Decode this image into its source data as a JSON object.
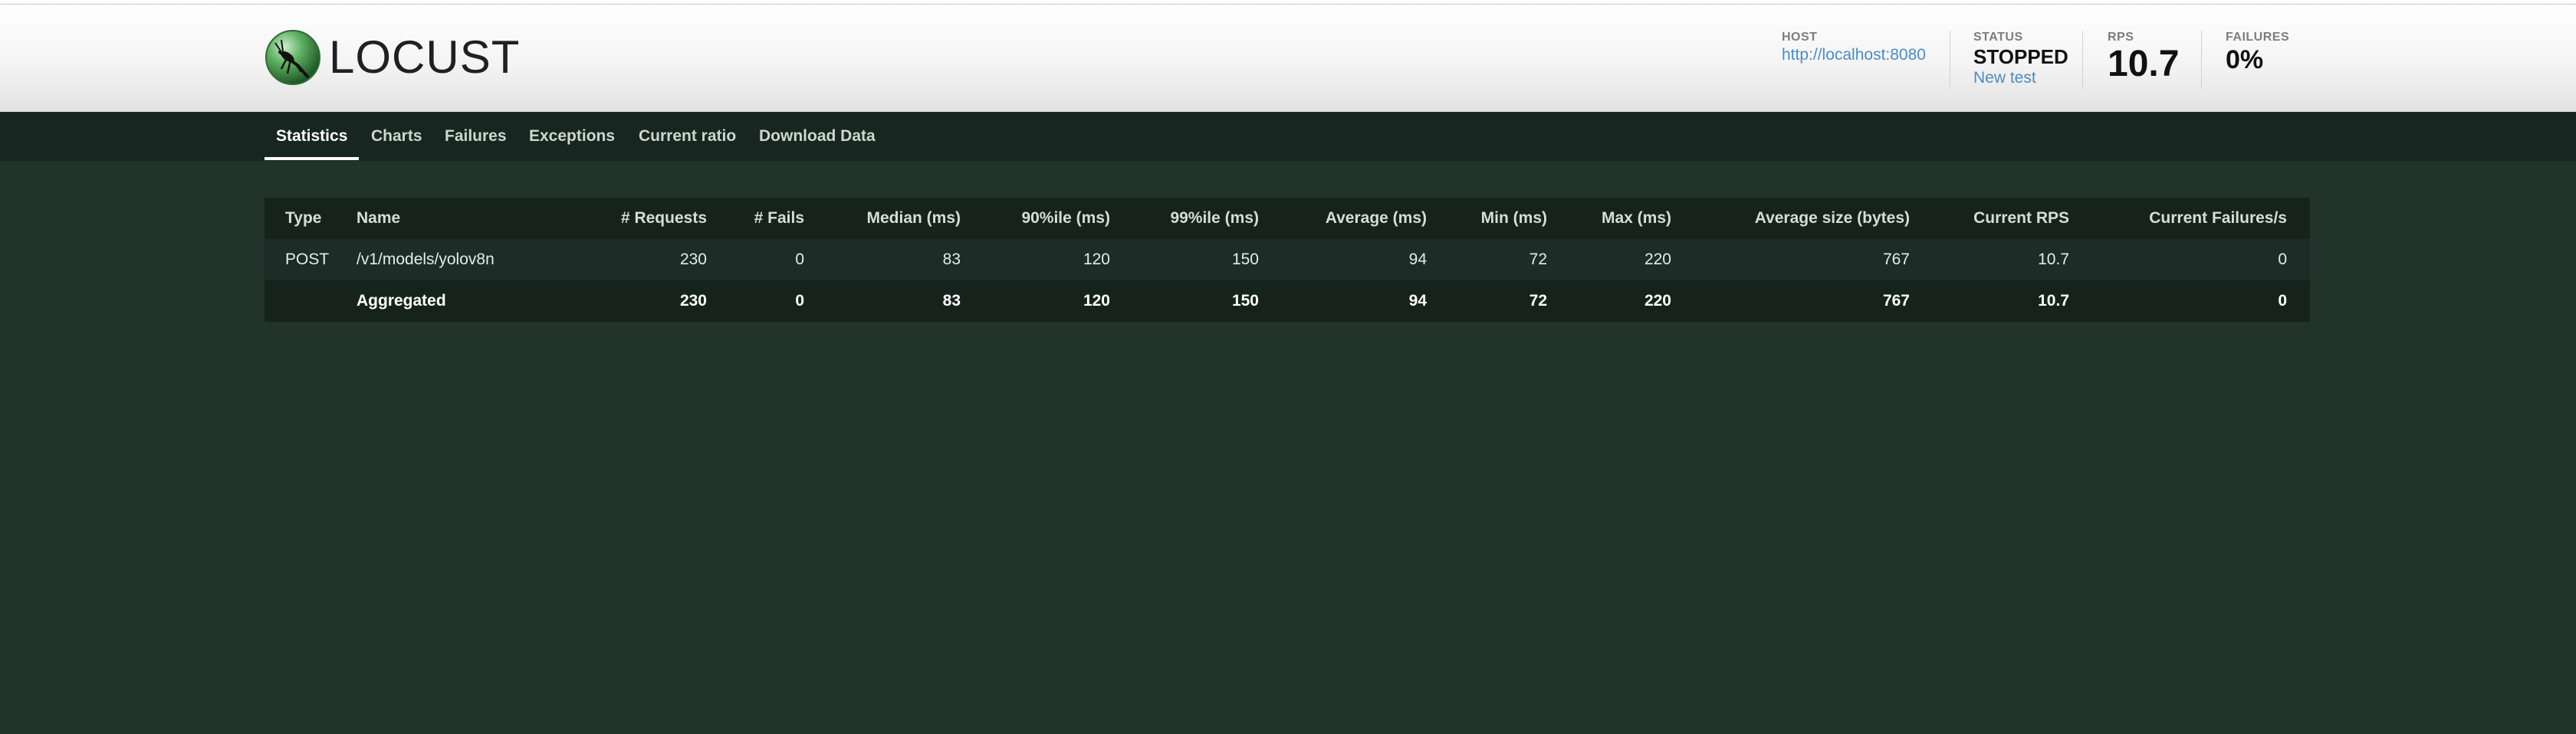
{
  "app": {
    "logo_text": "LOCUST"
  },
  "header": {
    "host": {
      "label": "HOST",
      "value": "http://localhost:8080"
    },
    "status": {
      "label": "STATUS",
      "value": "STOPPED",
      "new_test_label": "New test"
    },
    "rps": {
      "label": "RPS",
      "value": "10.7"
    },
    "failures": {
      "label": "FAILURES",
      "value": "0%"
    }
  },
  "tabs": [
    {
      "label": "Statistics",
      "active": true
    },
    {
      "label": "Charts",
      "active": false
    },
    {
      "label": "Failures",
      "active": false
    },
    {
      "label": "Exceptions",
      "active": false
    },
    {
      "label": "Current ratio",
      "active": false
    },
    {
      "label": "Download Data",
      "active": false
    }
  ],
  "table": {
    "columns": [
      "Type",
      "Name",
      "# Requests",
      "# Fails",
      "Median (ms)",
      "90%ile (ms)",
      "99%ile (ms)",
      "Average (ms)",
      "Min (ms)",
      "Max (ms)",
      "Average size (bytes)",
      "Current RPS",
      "Current Failures/s"
    ],
    "rows": [
      [
        "POST",
        "/v1/models/yolov8n",
        "230",
        "0",
        "83",
        "120",
        "150",
        "94",
        "72",
        "220",
        "767",
        "10.7",
        "0"
      ]
    ],
    "aggregated": [
      "",
      "Aggregated",
      "230",
      "0",
      "83",
      "120",
      "150",
      "94",
      "72",
      "220",
      "767",
      "10.7",
      "0"
    ]
  },
  "colors": {
    "background": "#21332b",
    "nav_bar": "#172620",
    "link": "#4a8cc7"
  }
}
